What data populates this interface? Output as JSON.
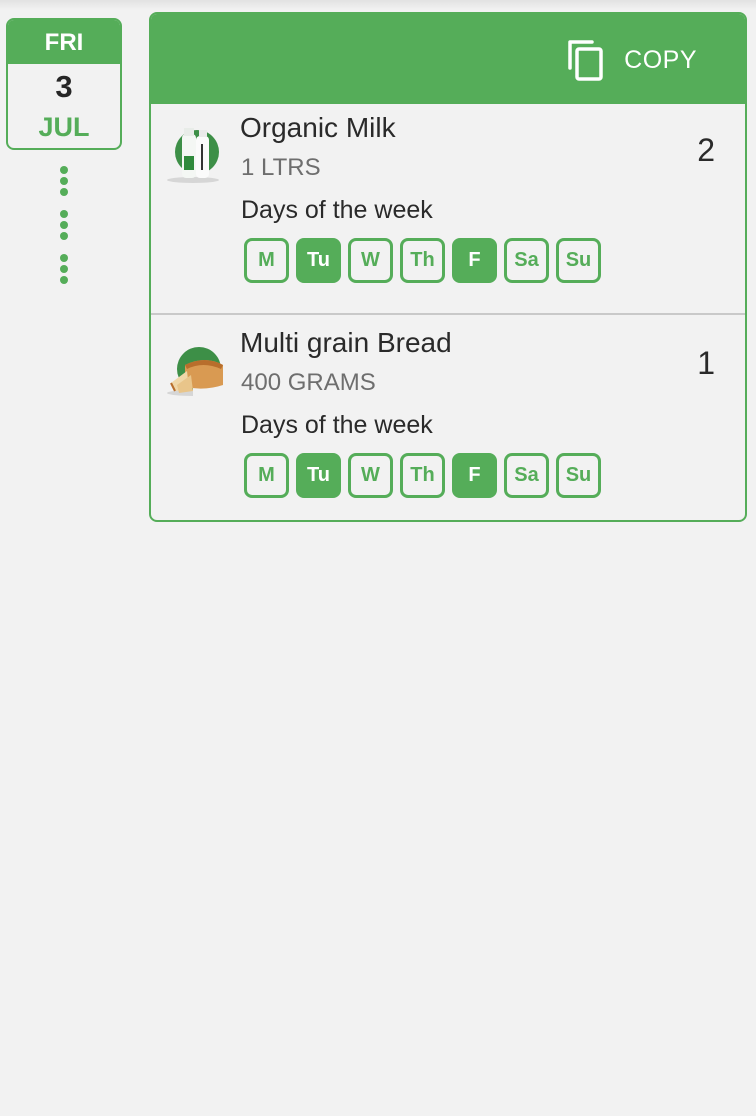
{
  "date": {
    "day_of_week": "FRI",
    "day": "3",
    "month": "JUL"
  },
  "header": {
    "copy_label": "COPY",
    "copy_icon": "copy-icon"
  },
  "colors": {
    "accent": "#55ad59",
    "background": "#f2f2f2",
    "text": "#2a2a2a",
    "muted": "#6e6e6e"
  },
  "items": [
    {
      "name": "Organic Milk",
      "size": "1 LTRS",
      "quantity": "2",
      "days_label": "Days of the week",
      "icon": "milk-bottles-icon",
      "days": [
        {
          "label": "M",
          "selected": false
        },
        {
          "label": "Tu",
          "selected": true
        },
        {
          "label": "W",
          "selected": false
        },
        {
          "label": "Th",
          "selected": false
        },
        {
          "label": "F",
          "selected": true
        },
        {
          "label": "Sa",
          "selected": false
        },
        {
          "label": "Su",
          "selected": false
        }
      ]
    },
    {
      "name": "Multi grain Bread",
      "size": "400 GRAMS",
      "quantity": "1",
      "days_label": "Days of the week",
      "icon": "bread-loaf-icon",
      "days": [
        {
          "label": "M",
          "selected": false
        },
        {
          "label": "Tu",
          "selected": true
        },
        {
          "label": "W",
          "selected": false
        },
        {
          "label": "Th",
          "selected": false
        },
        {
          "label": "F",
          "selected": true
        },
        {
          "label": "Sa",
          "selected": false
        },
        {
          "label": "Su",
          "selected": false
        }
      ]
    }
  ]
}
